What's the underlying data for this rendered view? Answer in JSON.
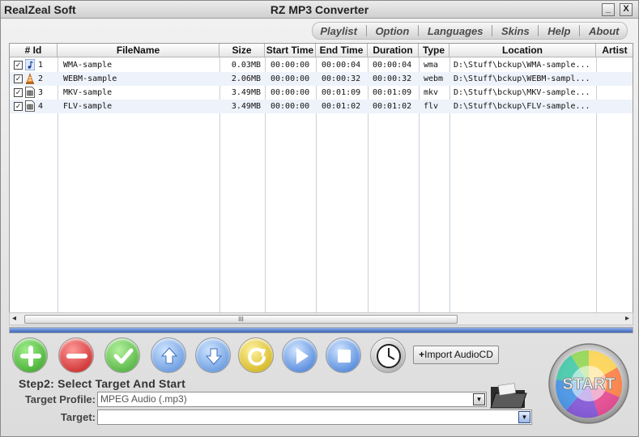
{
  "title_bar": {
    "brand": "RealZeal Soft",
    "app_title": "RZ MP3 Converter",
    "minimize": "_",
    "close": "X"
  },
  "menu": {
    "items": [
      "Playlist",
      "Option",
      "Languages",
      "Skins",
      "Help",
      "About"
    ]
  },
  "table": {
    "columns": [
      "# Id",
      "FileName",
      "Size",
      "Start Time",
      "End Time",
      "Duration",
      "Type",
      "Location",
      "Artist"
    ],
    "rows": [
      {
        "id": "1",
        "filename": "WMA-sample",
        "size": "0.03MB",
        "start": "00:00:00",
        "end": "00:00:04",
        "duration": "00:00:04",
        "type": "wma",
        "location": "D:\\Stuff\\bckup\\WMA-sample...",
        "icon": "audio-note-icon",
        "checked": true
      },
      {
        "id": "2",
        "filename": "WEBM-sample",
        "size": "2.06MB",
        "start": "00:00:00",
        "end": "00:00:32",
        "duration": "00:00:32",
        "type": "webm",
        "location": "D:\\Stuff\\bckup\\WEBM-sampl...",
        "icon": "vlc-cone-icon",
        "checked": true
      },
      {
        "id": "3",
        "filename": "MKV-sample",
        "size": "3.49MB",
        "start": "00:00:00",
        "end": "00:01:09",
        "duration": "00:01:09",
        "type": "mkv",
        "location": "D:\\Stuff\\bckup\\MKV-sample...",
        "icon": "video-file-icon",
        "checked": true
      },
      {
        "id": "4",
        "filename": "FLV-sample",
        "size": "3.49MB",
        "start": "00:00:00",
        "end": "00:01:02",
        "duration": "00:01:02",
        "type": "flv",
        "location": "D:\\Stuff\\bckup\\FLV-sample...",
        "icon": "video-file-icon",
        "checked": true
      }
    ]
  },
  "scroll": {
    "thumb_grip": "III",
    "left_arrow": "◂",
    "right_arrow": "▸"
  },
  "progress": {
    "value": 1.0,
    "color": "#3b63b5"
  },
  "toolbar": {
    "buttons": [
      "add-icon",
      "remove-icon",
      "check-icon",
      "move-up-icon",
      "move-down-icon",
      "refresh-icon",
      "play-icon",
      "stop-icon",
      "clock-icon"
    ],
    "import_label": "Import AudioCD"
  },
  "bottom": {
    "step_label": "Step2: Select Target And Start",
    "profile_label": "Target Profile:",
    "profile_value": "MPEG Audio (.mp3)",
    "target_label": "Target:",
    "target_value": "",
    "start_label": "START"
  }
}
